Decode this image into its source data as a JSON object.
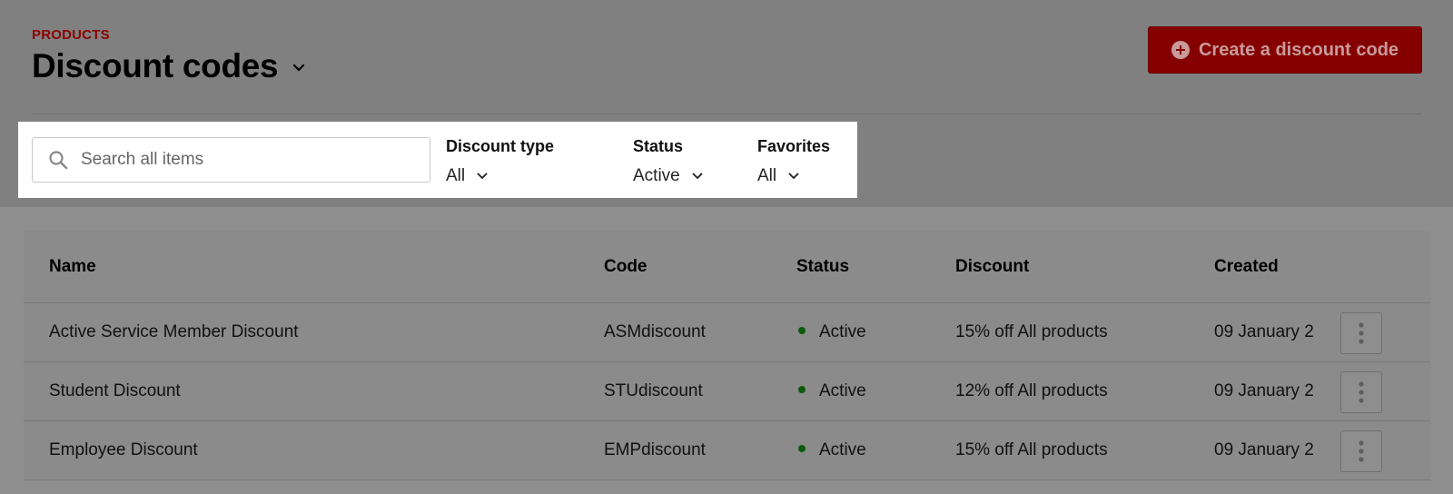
{
  "header": {
    "eyebrow": "PRODUCTS",
    "title": "Discount codes",
    "create_button": "Create a discount code"
  },
  "filters": {
    "search_placeholder": "Search all items",
    "items": [
      {
        "label": "Discount type",
        "value": "All"
      },
      {
        "label": "Status",
        "value": "Active"
      },
      {
        "label": "Favorites",
        "value": "All"
      }
    ]
  },
  "table": {
    "columns": [
      "Name",
      "Code",
      "Status",
      "Discount",
      "Created"
    ],
    "rows": [
      {
        "name": "Active Service Member Discount",
        "code": "ASMdiscount",
        "status": "Active",
        "discount": "15% off All products",
        "created": "09 January 2"
      },
      {
        "name": "Student Discount",
        "code": "STUdiscount",
        "status": "Active",
        "discount": "12% off All products",
        "created": "09 January 2"
      },
      {
        "name": "Employee Discount",
        "code": "EMPdiscount",
        "status": "Active",
        "discount": "15% off All products",
        "created": "09 January 2"
      }
    ]
  },
  "colors": {
    "accent": "#850000",
    "eyebrow": "#8e0000",
    "status_active": "#0b5a0b",
    "overlay_background": "#808080"
  },
  "icons": {
    "title_dropdown": "chevron-down-icon",
    "create": "plus-circle-icon",
    "search": "search-icon",
    "filter_dropdown": "chevron-down-icon",
    "row_actions": "kebab-icon"
  }
}
